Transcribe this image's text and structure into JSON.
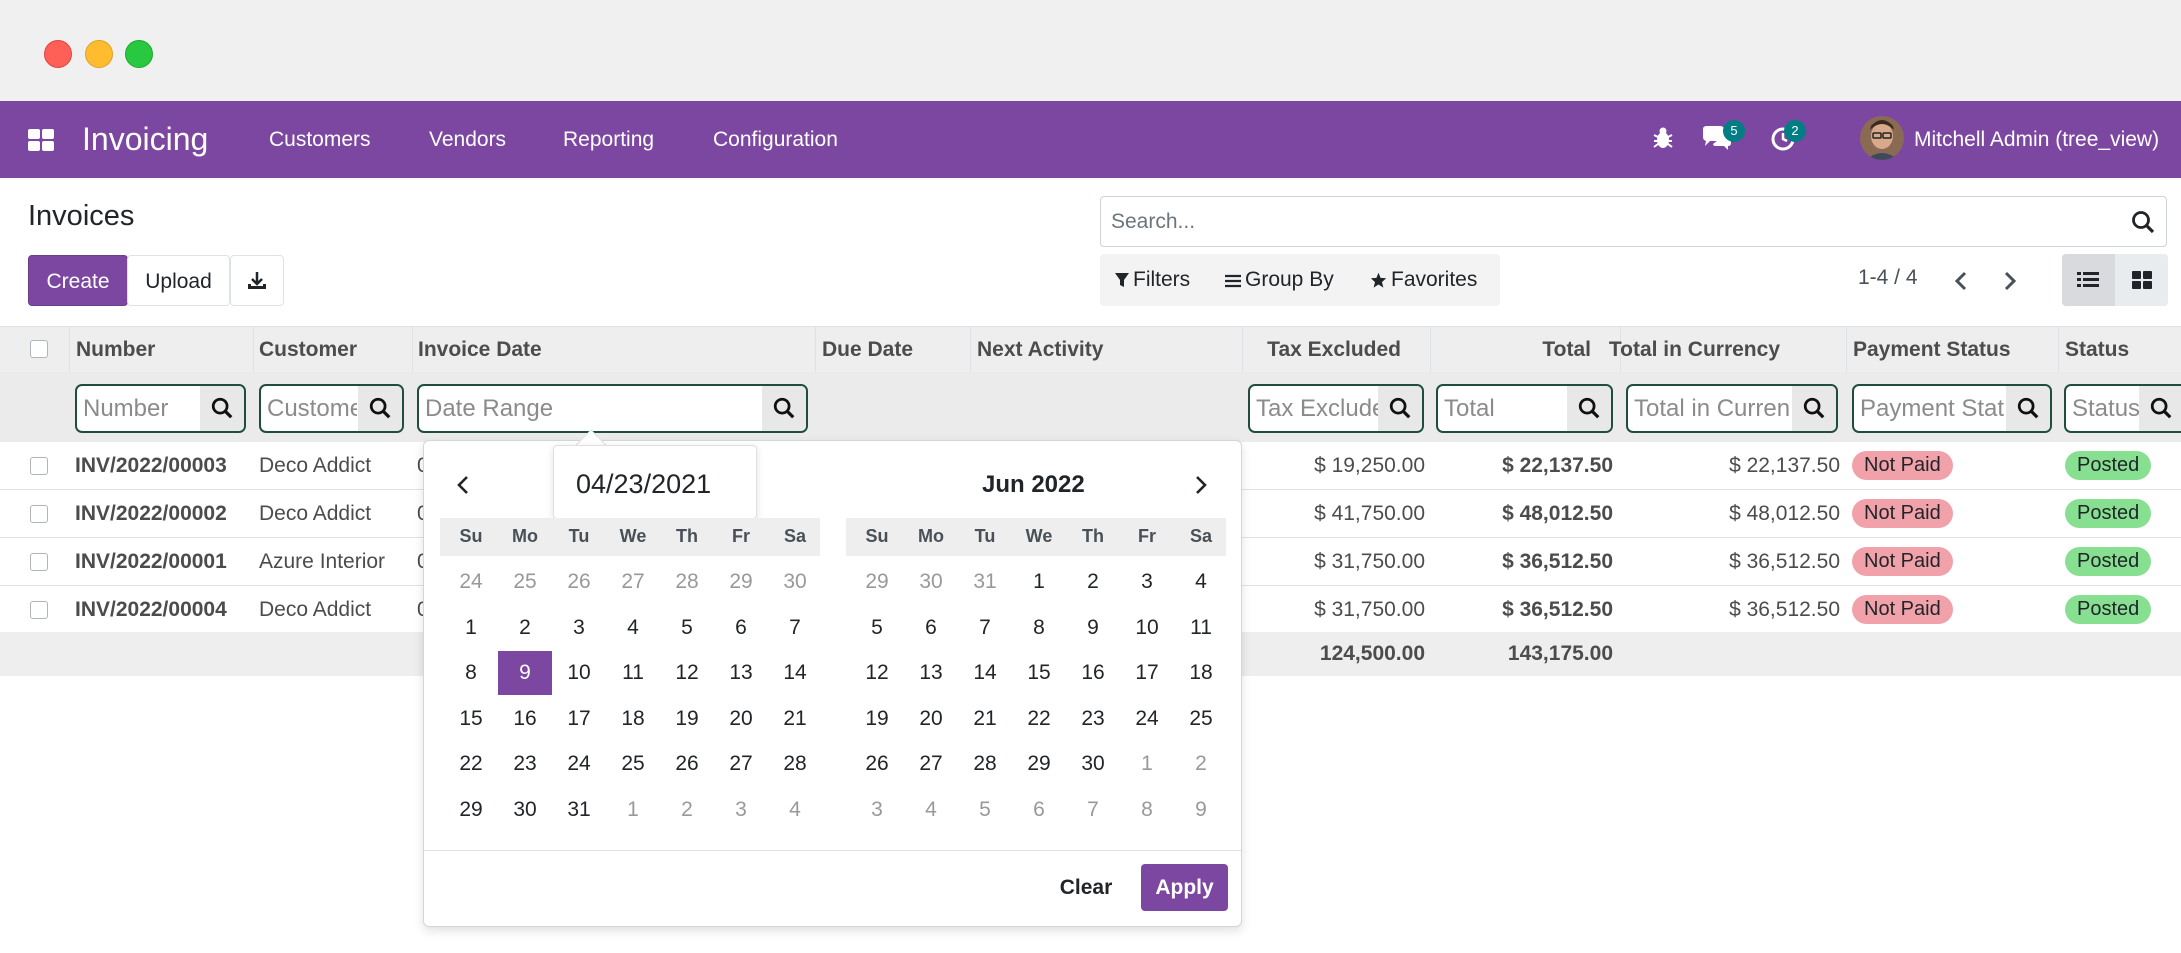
{
  "app": {
    "title": "Invoicing",
    "menu": [
      "Customers",
      "Vendors",
      "Reporting",
      "Configuration"
    ],
    "messages_count": "5",
    "activities_count": "2",
    "user": "Mitchell Admin (tree_view)"
  },
  "control_panel": {
    "page_title": "Invoices",
    "create_label": "Create",
    "upload_label": "Upload",
    "search_placeholder": "Search...",
    "filters_label": "Filters",
    "groupby_label": "Group By",
    "favorites_label": "Favorites",
    "pager": "1-4 / 4"
  },
  "table": {
    "headers": {
      "number": "Number",
      "customer": "Customer",
      "invoice_date": "Invoice Date",
      "due_date": "Due Date",
      "next_activity": "Next Activity",
      "tax_excluded": "Tax Excluded",
      "total": "Total",
      "total_currency": "Total in Currency",
      "payment_status": "Payment Status",
      "status": "Status"
    },
    "filters": {
      "number": "Number",
      "customer": "Customer",
      "invoice_date": "Date Range",
      "tax_excluded": "Tax Excluded",
      "total": "Total",
      "total_currency": "Total in Currency",
      "payment_status": "Payment Status",
      "status": "Status"
    },
    "rows": [
      {
        "number": "INV/2022/00003",
        "customer": "Deco Addict",
        "date_stub": "0",
        "tax_excluded": "$ 19,250.00",
        "total": "$ 22,137.50",
        "total_currency": "$ 22,137.50",
        "payment_status": "Not Paid",
        "status": "Posted"
      },
      {
        "number": "INV/2022/00002",
        "customer": "Deco Addict",
        "date_stub": "0",
        "tax_excluded": "$ 41,750.00",
        "total": "$ 48,012.50",
        "total_currency": "$ 48,012.50",
        "payment_status": "Not Paid",
        "status": "Posted"
      },
      {
        "number": "INV/2022/00001",
        "customer": "Azure Interior",
        "date_stub": "0",
        "tax_excluded": "$ 31,750.00",
        "total": "$ 36,512.50",
        "total_currency": "$ 36,512.50",
        "payment_status": "Not Paid",
        "status": "Posted"
      },
      {
        "number": "INV/2022/00004",
        "customer": "Deco Addict",
        "date_stub": "0",
        "tax_excluded": "$ 31,750.00",
        "total": "$ 36,512.50",
        "total_currency": "$ 36,512.50",
        "payment_status": "Not Paid",
        "status": "Posted"
      }
    ],
    "totals": {
      "tax_excluded": "124,500.00",
      "total": "143,175.00"
    }
  },
  "datepicker": {
    "tooltip_value": "04/23/2021",
    "left_month": "",
    "right_month": "Jun 2022",
    "dow": [
      "Su",
      "Mo",
      "Tu",
      "We",
      "Th",
      "Fr",
      "Sa"
    ],
    "left_days": [
      [
        "24",
        "25",
        "26",
        "27",
        "28",
        "29",
        "30"
      ],
      [
        "1",
        "2",
        "3",
        "4",
        "5",
        "6",
        "7"
      ],
      [
        "8",
        "9",
        "10",
        "11",
        "12",
        "13",
        "14"
      ],
      [
        "15",
        "16",
        "17",
        "18",
        "19",
        "20",
        "21"
      ],
      [
        "22",
        "23",
        "24",
        "25",
        "26",
        "27",
        "28"
      ],
      [
        "29",
        "30",
        "31",
        "1",
        "2",
        "3",
        "4"
      ]
    ],
    "right_days": [
      [
        "29",
        "30",
        "31",
        "1",
        "2",
        "3",
        "4"
      ],
      [
        "5",
        "6",
        "7",
        "8",
        "9",
        "10",
        "11"
      ],
      [
        "12",
        "13",
        "14",
        "15",
        "16",
        "17",
        "18"
      ],
      [
        "19",
        "20",
        "21",
        "22",
        "23",
        "24",
        "25"
      ],
      [
        "26",
        "27",
        "28",
        "29",
        "30",
        "1",
        "2"
      ],
      [
        "3",
        "4",
        "5",
        "6",
        "7",
        "8",
        "9"
      ]
    ],
    "selected_day": "9",
    "clear_label": "Clear",
    "apply_label": "Apply"
  },
  "colors": {
    "brand": "#7c47a1",
    "badge_teal": "#017e84",
    "not_paid": "#f1a1a9",
    "posted": "#87e091"
  }
}
